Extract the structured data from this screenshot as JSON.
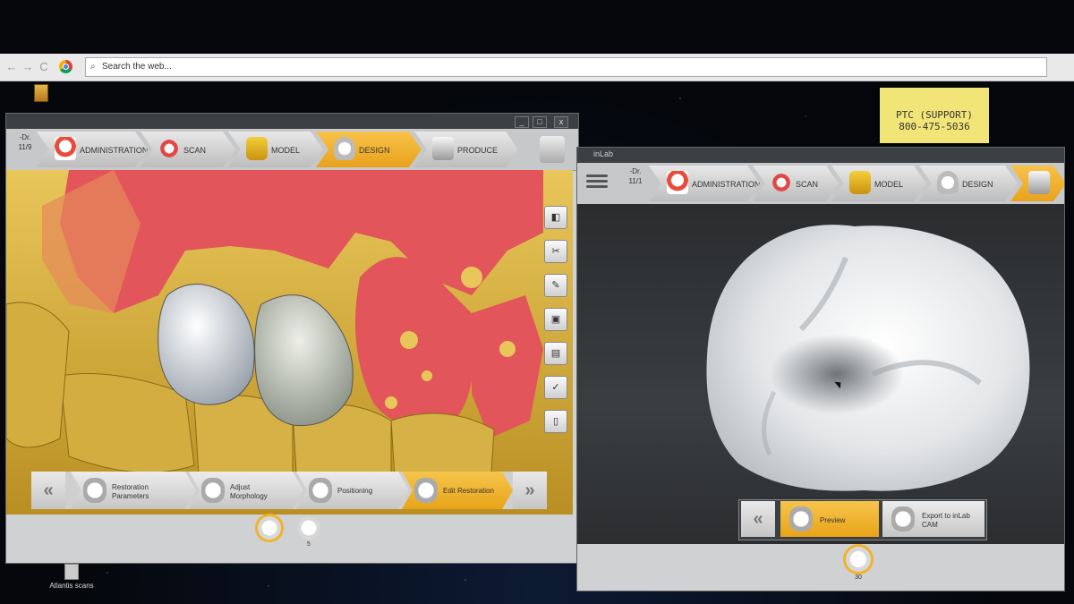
{
  "browser": {
    "back": "←",
    "forward": "→",
    "reload": "C",
    "search_placeholder": "Search the web..."
  },
  "sticky_note": {
    "line1": "PTC (SUPPORT)",
    "line2": "800-475-5036"
  },
  "left_window": {
    "controls": [
      "_",
      "□",
      "x"
    ],
    "doctor": [
      "-Dr.",
      "11/9"
    ],
    "stages": [
      {
        "label": "ADMINISTRATION",
        "icon": "administration-icon",
        "active": false
      },
      {
        "label": "SCAN",
        "icon": "scan-icon",
        "active": false
      },
      {
        "label": "MODEL",
        "icon": "model-icon",
        "active": false
      },
      {
        "label": "DESIGN",
        "icon": "design-icon",
        "active": true
      },
      {
        "label": "PRODUCE",
        "icon": "produce-icon",
        "active": false
      }
    ],
    "workflow": [
      {
        "label_line1": "Restoration",
        "label_line2": "Parameters",
        "active": false
      },
      {
        "label_line1": "Adjust",
        "label_line2": "Morphology",
        "active": false
      },
      {
        "label_line1": "Positioning",
        "label_line2": "",
        "active": false
      },
      {
        "label_line1": "Edit Restoration",
        "label_line2": "",
        "active": true
      }
    ],
    "prev_btn": "«",
    "next_btn": "»",
    "thumbnails": [
      {
        "label": "",
        "selected": true
      },
      {
        "label": "5",
        "selected": false
      }
    ]
  },
  "right_window": {
    "title": "inLab",
    "doctor": [
      "-Dr.",
      "11/1"
    ],
    "stages": [
      {
        "label": "ADMINISTRATION",
        "icon": "administration-icon",
        "active": false
      },
      {
        "label": "SCAN",
        "icon": "scan-icon",
        "active": false
      },
      {
        "label": "MODEL",
        "icon": "model-icon",
        "active": false
      },
      {
        "label": "DESIGN",
        "icon": "design-icon",
        "active": false
      },
      {
        "label": "",
        "icon": "produce-icon",
        "active": true
      }
    ],
    "workflow": [
      {
        "label_line1": "Preview",
        "label_line2": "",
        "active": true
      },
      {
        "label_line1": "Export to inLab",
        "label_line2": "CAM",
        "active": false
      }
    ],
    "prev_btn": "«",
    "thumbnail_label": "30"
  },
  "desktop": {
    "bottom_icon_label": "Atlantis scans"
  },
  "colors": {
    "accent": "#f1b32a",
    "stone_model": "#d7b346",
    "gingiva": "#e2555a",
    "crown": "#dfe3e6"
  }
}
